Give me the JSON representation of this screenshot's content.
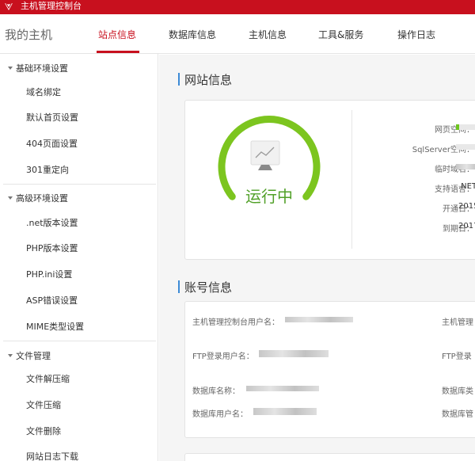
{
  "topbar": {
    "title": "主机管理控制台"
  },
  "nav": {
    "brand": "我的主机",
    "tabs": [
      {
        "label": "站点信息",
        "active": true
      },
      {
        "label": "数据库信息",
        "active": false
      },
      {
        "label": "主机信息",
        "active": false
      },
      {
        "label": "工具&服务",
        "active": false
      },
      {
        "label": "操作日志",
        "active": false
      }
    ]
  },
  "sidebar": {
    "groups": [
      {
        "label": "基础环境设置",
        "items": [
          "域名绑定",
          "默认首页设置",
          "404页面设置",
          "301重定向"
        ]
      },
      {
        "label": "高级环境设置",
        "items": [
          ".net版本设置",
          "PHP版本设置",
          "PHP.ini设置",
          "ASP错误设置",
          "MIME类型设置"
        ]
      },
      {
        "label": "文件管理",
        "items": [
          "文件解压缩",
          "文件压缩",
          "文件删除",
          "网站日志下载"
        ]
      }
    ]
  },
  "site_info": {
    "title": "网站信息",
    "status": "运行中",
    "fields": [
      {
        "label": "网页空间：",
        "value": ""
      },
      {
        "label": "SqlServer空间：",
        "value": ""
      },
      {
        "label": "临时域名：",
        "value": ""
      },
      {
        "label": "支持语言：",
        "value": ".NET"
      },
      {
        "label": "开通日：",
        "value": "2015"
      },
      {
        "label": "到期日：",
        "value": "2017"
      }
    ]
  },
  "account_info": {
    "title": "账号信息",
    "left_fields": [
      "主机管理控制台用户名：",
      "FTP登录用户名：",
      "数据库名称：",
      "数据库用户名："
    ],
    "right_fields": [
      "主机管理",
      "FTP登录",
      "数据库类",
      "数据库管"
    ]
  },
  "colors": {
    "brand_red": "#c8101e",
    "running_green": "#51a028",
    "gauge_green": "#7cc51f",
    "section_accent": "#3c8ad6"
  },
  "icons": {
    "logo": "chinanet-logo-icon",
    "monitor": "chart-monitor-icon",
    "caret": "caret-down-icon"
  }
}
